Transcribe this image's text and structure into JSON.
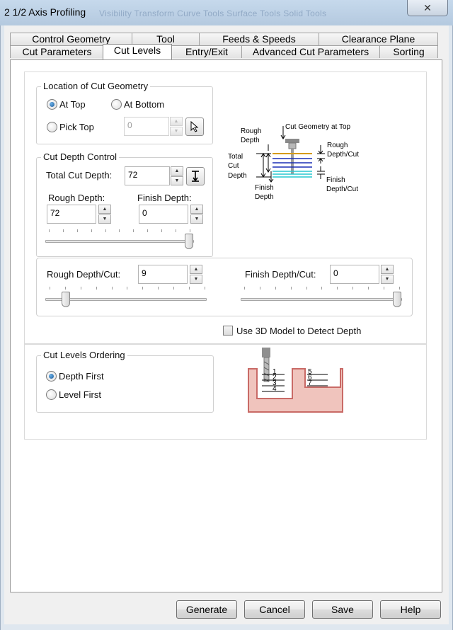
{
  "window": {
    "title": "2 1/2 Axis Profiling",
    "background_toolbar_text": "Visibility     Transform     Curve Tools     Surface Tools     Solid Tools",
    "close_label": "✕"
  },
  "tabs": {
    "row1": [
      "Control Geometry",
      "Tool",
      "Feeds & Speeds",
      "Clearance Plane"
    ],
    "row2": [
      "Cut Parameters",
      "Cut Levels",
      "Entry/Exit",
      "Advanced Cut Parameters",
      "Sorting"
    ],
    "active": "Cut Levels"
  },
  "location": {
    "title": "Location of Cut Geometry",
    "at_top": "At Top",
    "at_bottom": "At Bottom",
    "pick_top": "Pick Top",
    "pick_top_value": "0",
    "selected": "At Top"
  },
  "depth_control": {
    "title": "Cut Depth Control",
    "total_label": "Total Cut Depth:",
    "total_value": "72",
    "rough_label": "Rough Depth:",
    "rough_value": "72",
    "finish_label": "Finish Depth:",
    "finish_value": "0",
    "slider_position": 1.0
  },
  "per_cut": {
    "rough_label": "Rough Depth/Cut:",
    "rough_value": "9",
    "finish_label": "Finish Depth/Cut:",
    "finish_value": "0",
    "rough_slider_position": 0.1,
    "finish_slider_position": 1.0
  },
  "use_3d_model": {
    "label": "Use 3D Model to Detect Depth",
    "checked": false
  },
  "ordering": {
    "title": "Cut Levels Ordering",
    "depth_first": "Depth First",
    "level_first": "Level First",
    "selected": "Depth First"
  },
  "depth_diagram": {
    "cut_geometry_at_top": "Cut Geometry at Top",
    "rough_depth_1": "Rough",
    "rough_depth_2": "Depth",
    "total_1": "Total",
    "total_2": "Cut",
    "total_3": "Depth",
    "finish_depth_1": "Finish",
    "finish_depth_2": "Depth",
    "rough_per_cut_1": "Rough",
    "rough_per_cut_2": "Depth/Cut",
    "finish_per_cut_1": "Finish",
    "finish_per_cut_2": "Depth/Cut"
  },
  "ordering_diagram": {
    "left_levels": [
      "1",
      "2",
      "3",
      "4"
    ],
    "right_levels": [
      "5",
      "6",
      "7"
    ]
  },
  "buttons": {
    "generate": "Generate",
    "cancel": "Cancel",
    "save": "Save",
    "help": "Help"
  },
  "colors": {
    "pocket_fill": "#f0c4bd",
    "pocket_stroke": "#c96a66",
    "geometry_line": "#d69b18",
    "rough_lines": "#1a2fb5",
    "finish_lines": "#27c7cf",
    "radio_selected": "#1f5c99"
  }
}
